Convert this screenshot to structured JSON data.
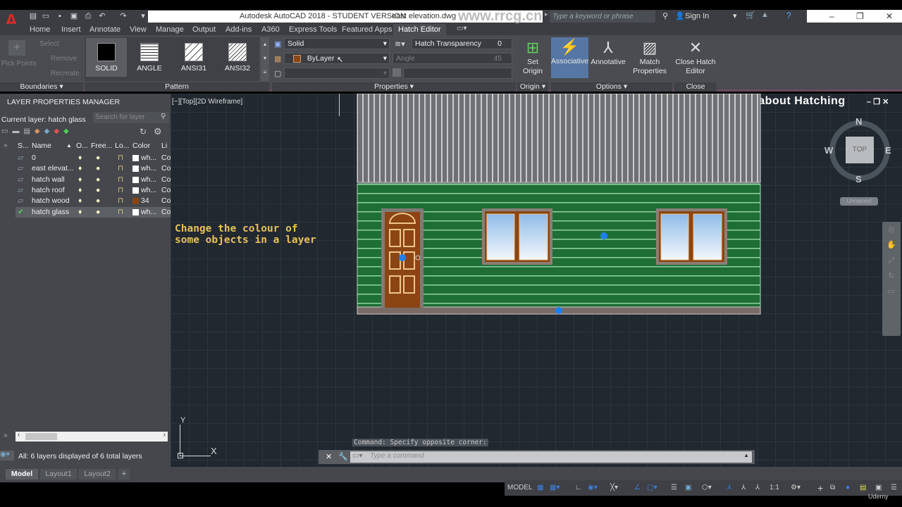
{
  "app": {
    "title": "Autodesk AutoCAD 2018 - STUDENT VERSION",
    "file_name": "east elevation.dwg",
    "watermark": "www.rrcg.cn",
    "search_placeholder": "Type a keyword or phrase",
    "sign_in": "Sign In",
    "logo": "A"
  },
  "ribbon_tabs": [
    "Home",
    "Insert",
    "Annotate",
    "View",
    "Manage",
    "Output",
    "Add-ins",
    "A360",
    "Express Tools",
    "Featured Apps",
    "Hatch Editor"
  ],
  "active_tab": "Hatch Editor",
  "ribbon": {
    "boundaries": {
      "pick_points": "Pick Points",
      "select": "Select",
      "remove": "Remove",
      "recreate": "Recreate",
      "label": "Boundaries"
    },
    "pattern": {
      "items": [
        "SOLID",
        "ANGLE",
        "ANSI31",
        "ANSI32"
      ],
      "selected": "SOLID",
      "label": "Pattern"
    },
    "properties": {
      "hatch_type": "Solid",
      "hatch_color": "ByLayer",
      "hatch_color_swatch": "#8b4513",
      "transparency_label": "Hatch Transparency",
      "transparency_value": "0",
      "angle_label": "Angle",
      "angle_value": "45",
      "label": "Properties"
    },
    "origin": {
      "set_origin": "Set Origin",
      "label": "Origin"
    },
    "options": {
      "associative": "Associative",
      "annotative": "Annotative",
      "match_properties": "Match Properties",
      "label": "Options"
    },
    "close": {
      "close_hatch_editor": "Close Hatch Editor",
      "label": "Close"
    }
  },
  "layer_manager": {
    "title": "LAYER PROPERTIES MANAGER",
    "current_layer": "Current layer: hatch glass",
    "search_placeholder": "Search for layer",
    "columns": [
      "S...",
      "Name",
      "O...",
      "Free...",
      "Lo...",
      "Color",
      "Li"
    ],
    "layers": [
      {
        "name": "0",
        "color": "wh...",
        "swatch": "#ffffff",
        "linetype": "Co",
        "current": false
      },
      {
        "name": "east elevat...",
        "color": "wh...",
        "swatch": "#ffffff",
        "linetype": "Co",
        "current": false
      },
      {
        "name": "hatch wall",
        "color": "wh...",
        "swatch": "#ffffff",
        "linetype": "Co",
        "current": false
      },
      {
        "name": "hatch roof",
        "color": "wh...",
        "swatch": "#ffffff",
        "linetype": "Co",
        "current": false
      },
      {
        "name": "hatch wood",
        "color": "34",
        "swatch": "#8b4513",
        "linetype": "Co",
        "current": false
      },
      {
        "name": "hatch glass",
        "color": "wh...",
        "swatch": "#ffffff",
        "linetype": "Co",
        "current": true
      }
    ],
    "status": "All: 6 layers displayed of 6 total layers"
  },
  "viewport": {
    "label": "[−][Top][2D Wireframe]",
    "overlay_title": "Fast tips about Hatching",
    "annotation_line1": "Change the colour of",
    "annotation_line2": "some objects in a layer",
    "viewcube": {
      "n": "N",
      "s": "S",
      "e": "E",
      "w": "W",
      "face": "TOP",
      "ucs": "Unnamed"
    },
    "axis_x": "X",
    "axis_y": "Y"
  },
  "command": {
    "history": "Command: Specify opposite corner:",
    "placeholder": "Type a command"
  },
  "layout_tabs": [
    "Model",
    "Layout1",
    "Layout2",
    "+"
  ],
  "status_bar": {
    "model": "MODEL",
    "scale": "1:1",
    "brand": "Udemy"
  }
}
